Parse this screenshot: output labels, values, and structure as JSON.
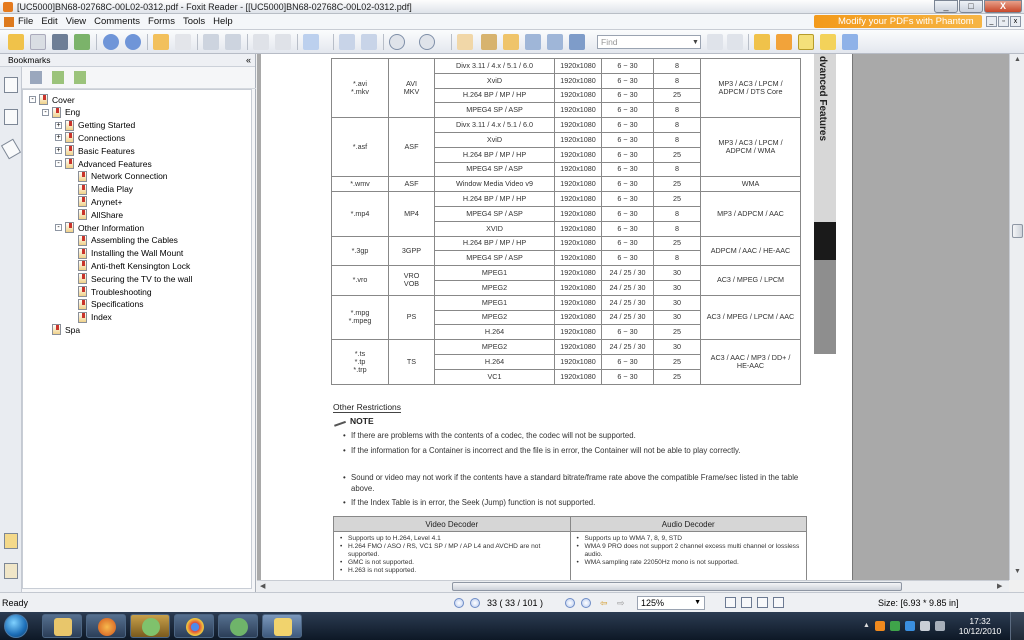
{
  "window": {
    "title": "[UC5000]BN68-02768C-00L02-0312.pdf - Foxit Reader - [[UC5000]BN68-02768C-00L02-0312.pdf]",
    "min_label": "_",
    "max_label": "□",
    "close_label": "X"
  },
  "menu": {
    "items": [
      "File",
      "Edit",
      "View",
      "Comments",
      "Forms",
      "Tools",
      "Help"
    ],
    "banner": "Modify your PDFs with Phantom"
  },
  "toolbar": {
    "find_placeholder": "Find"
  },
  "bookmarks": {
    "header": "Bookmarks",
    "collapse": "«",
    "tree": [
      {
        "label": "Cover",
        "depth": 0,
        "expander": "-"
      },
      {
        "label": "Eng",
        "depth": 1,
        "expander": "-"
      },
      {
        "label": "Getting Started",
        "depth": 2,
        "expander": "+"
      },
      {
        "label": "Connections",
        "depth": 2,
        "expander": "+"
      },
      {
        "label": "Basic Features",
        "depth": 2,
        "expander": "+"
      },
      {
        "label": "Advanced Features",
        "depth": 2,
        "expander": "-"
      },
      {
        "label": "Network Connection",
        "depth": 3,
        "expander": ""
      },
      {
        "label": "Media Play",
        "depth": 3,
        "expander": ""
      },
      {
        "label": "Anynet+",
        "depth": 3,
        "expander": ""
      },
      {
        "label": "AllShare",
        "depth": 3,
        "expander": ""
      },
      {
        "label": "Other Information",
        "depth": 2,
        "expander": "-"
      },
      {
        "label": "Assembling the Cables",
        "depth": 3,
        "expander": ""
      },
      {
        "label": "Installing the Wall Mount",
        "depth": 3,
        "expander": ""
      },
      {
        "label": "Anti-theft Kensington Lock",
        "depth": 3,
        "expander": ""
      },
      {
        "label": "Securing the TV to the wall",
        "depth": 3,
        "expander": ""
      },
      {
        "label": "Troubleshooting",
        "depth": 3,
        "expander": ""
      },
      {
        "label": "Specifications",
        "depth": 3,
        "expander": ""
      },
      {
        "label": "Index",
        "depth": 3,
        "expander": ""
      },
      {
        "label": "Spa",
        "depth": 1,
        "expander": ""
      }
    ]
  },
  "document": {
    "side_label": "dvanced Features",
    "codec_groups": [
      {
        "ext": "*.avi\n*.mkv",
        "container": "AVI\nMKV",
        "audio": "MP3 / AC3 / LPCM /\nADPCM / DTS Core",
        "rows": [
          [
            "Divx 3.11 / 4.x / 5.1 / 6.0",
            "1920x1080",
            "6 ~ 30",
            "8"
          ],
          [
            "XviD",
            "1920x1080",
            "6 ~ 30",
            "8"
          ],
          [
            "H.264 BP / MP / HP",
            "1920x1080",
            "6 ~ 30",
            "25"
          ],
          [
            "MPEG4 SP / ASP",
            "1920x1080",
            "6 ~ 30",
            "8"
          ]
        ]
      },
      {
        "ext": "*.asf",
        "container": "ASF",
        "audio": "MP3 / AC3 / LPCM /\nADPCM / WMA",
        "rows": [
          [
            "Divx 3.11 / 4.x / 5.1 / 6.0",
            "1920x1080",
            "6 ~ 30",
            "8"
          ],
          [
            "XviD",
            "1920x1080",
            "6 ~ 30",
            "8"
          ],
          [
            "H.264 BP / MP / HP",
            "1920x1080",
            "6 ~ 30",
            "25"
          ],
          [
            "MPEG4 SP / ASP",
            "1920x1080",
            "6 ~ 30",
            "8"
          ]
        ]
      },
      {
        "ext": "*.wmv",
        "container": "ASF",
        "audio": "WMA",
        "rows": [
          [
            "Window Media Video v9",
            "1920x1080",
            "6 ~ 30",
            "25"
          ]
        ]
      },
      {
        "ext": "*.mp4",
        "container": "MP4",
        "audio": "MP3 / ADPCM / AAC",
        "rows": [
          [
            "H.264 BP / MP / HP",
            "1920x1080",
            "6 ~ 30",
            "25"
          ],
          [
            "MPEG4 SP / ASP",
            "1920x1080",
            "6 ~ 30",
            "8"
          ],
          [
            "XVID",
            "1920x1080",
            "6 ~ 30",
            "8"
          ]
        ]
      },
      {
        "ext": "*.3gp",
        "container": "3GPP",
        "audio": "ADPCM / AAC / HE-AAC",
        "rows": [
          [
            "H.264 BP / MP / HP",
            "1920x1080",
            "6 ~ 30",
            "25"
          ],
          [
            "MPEG4 SP / ASP",
            "1920x1080",
            "6 ~ 30",
            "8"
          ]
        ]
      },
      {
        "ext": "*.vro",
        "container": "VRO\nVOB",
        "audio": "AC3 / MPEG / LPCM",
        "rows": [
          [
            "MPEG1",
            "1920x1080",
            "24 / 25 / 30",
            "30"
          ],
          [
            "MPEG2",
            "1920x1080",
            "24 / 25 / 30",
            "30"
          ]
        ]
      },
      {
        "ext": "*.mpg\n*.mpeg",
        "container": "PS",
        "audio": "AC3 / MPEG / LPCM / AAC",
        "rows": [
          [
            "MPEG1",
            "1920x1080",
            "24 / 25 / 30",
            "30"
          ],
          [
            "MPEG2",
            "1920x1080",
            "24 / 25 / 30",
            "30"
          ],
          [
            "H.264",
            "1920x1080",
            "6 ~ 30",
            "25"
          ]
        ]
      },
      {
        "ext": "*.ts\n*.tp\n*.trp",
        "container": "TS",
        "audio": "AC3 / AAC / MP3 / DD+ /\nHE-AAC",
        "rows": [
          [
            "MPEG2",
            "1920x1080",
            "24 / 25 / 30",
            "30"
          ],
          [
            "H.264",
            "1920x1080",
            "6 ~ 30",
            "25"
          ],
          [
            "VC1",
            "1920x1080",
            "6 ~ 30",
            "25"
          ]
        ]
      }
    ],
    "restrictions_heading": "Other Restrictions",
    "note_label": "NOTE",
    "notes": [
      "If there are problems with the contents of a codec, the codec will not be supported.",
      "If the information for a Container is incorrect and the file is in error, the Container will not be able to play correctly.",
      "Sound or video may not work if the contents have a standard bitrate/frame rate above the compatible Frame/sec listed in the table above.",
      "If the Index Table is in error, the Seek (Jump) function is not supported."
    ],
    "decoder": {
      "video_header": "Video Decoder",
      "audio_header": "Audio Decoder",
      "video_items": [
        "Supports up to H.264, Level 4.1",
        "H.264 FMO / ASO / RS, VC1 SP / MP / AP L4 and AVCHD are not supported.",
        "GMC is not supported.",
        "H.263 is not supported."
      ],
      "audio_items": [
        "Supports up to WMA 7, 8, 9, STD",
        "WMA 9 PRO does not support 2 channel excess multi channel or lossless audio.",
        "WMA sampling rate 22050Hz mono is not supported."
      ]
    }
  },
  "status": {
    "ready": "Ready",
    "page_display": "33   ( 33 / 101 )",
    "zoom": "125%",
    "size": "Size: [6.93 * 9.85 in]"
  },
  "taskbar": {
    "clock_time": "17:32",
    "clock_date": "10/12/2010"
  },
  "colors": {
    "banner_orange": "#f39a1b",
    "doc_background": "#a9a9a9",
    "taskbar_dark": "#0d1826"
  }
}
